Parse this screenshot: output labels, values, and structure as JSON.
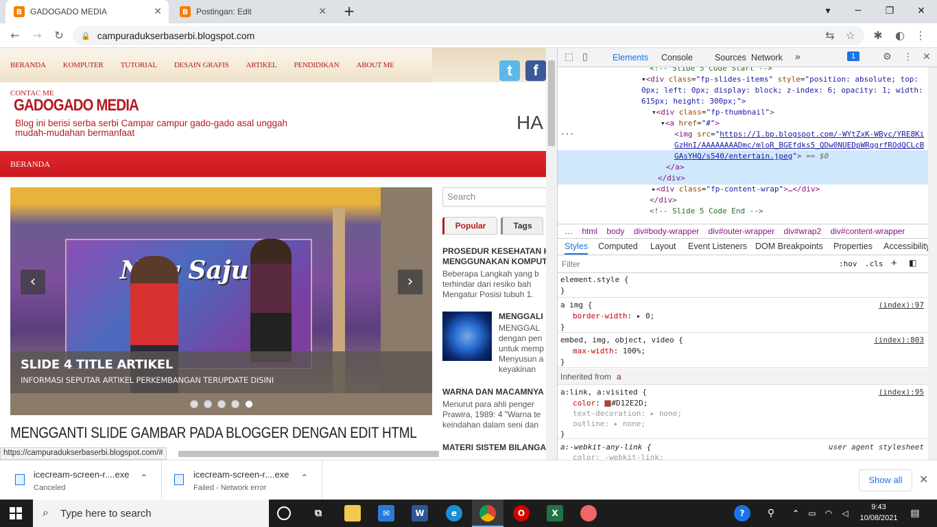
{
  "browser": {
    "tabs": [
      {
        "label": "GADOGADO MEDIA",
        "active": true
      },
      {
        "label": "Postingan: Edit",
        "active": false
      }
    ],
    "url": "campuradukserbaserbi.blogspot.com"
  },
  "page": {
    "menu": [
      "BERANDA",
      "KOMPUTER",
      "TUTORIAL",
      "DESAIN GRAFIS",
      "ARTIKEL",
      "PENDIDIKAN",
      "ABOUT ME"
    ],
    "contact": "CONTAC ME",
    "blog_title": "GADOGADO MEDIA",
    "blog_desc": "Blog ini berisi serba serbi Campar campur gado-gado asal unggah mudah-mudahan bermanfaat",
    "ha_text": "HA",
    "red_bar_label": "BERANDA",
    "slider": {
      "banner_text": "New Sajum",
      "caption_title": "SLIDE 4 TITLE ARTIKEL",
      "caption_sub": "INFORMASI SEPUTAR ARTIKEL PERKEMBANGAN TERUPDATE DISINI",
      "prev": "‹",
      "next": "›",
      "dots": 5,
      "active_dot": 5
    },
    "post_title": "MENGGANTI SLIDE GAMBAR PADA BLOGGER DENGAN EDIT HTML",
    "sidebar": {
      "search_placeholder": "Search",
      "tab_popular": "Popular",
      "tab_tags": "Tags",
      "post1_title_l1": "PROSEDUR KESEHATAN K",
      "post1_title_l2": "MENGGUNAKAN KOMPUT",
      "post1_text_l1": "Beberapa Langkah yang b",
      "post1_text_l2": "terhindar dari resiko bah",
      "post1_text_l3": "Mengatur Posisi tubuh 1.",
      "post2_title": "MENGGALI",
      "post2_text_l1": "MENGGAL",
      "post2_text_l2": "dengan pen",
      "post2_text_l3": "untuk memp",
      "post2_text_l4": "Menyusun a",
      "post2_text_l5": "keyakinan",
      "post3_title": "WARNA DAN MACAMNYA",
      "post3_text_l1": "Menurut  para ahli penger",
      "post3_text_l2": "Prawira, 1989: 4 \"Warna te",
      "post3_text_l3": "keindahan dalam seni dan",
      "post4_title": "MATERI SISTEM BILANGA"
    },
    "status_url": "https://campuradukserbaserbi.blogspot.com/#"
  },
  "devtools": {
    "tabs": [
      "Elements",
      "Console",
      "Sources",
      "Network"
    ],
    "more": "»",
    "issues_count": "1",
    "dom": {
      "l1": "<!-- Slide 5 Code Start -->",
      "l2_tag": "div",
      "l2_class": "fp-slides-items",
      "l2_style": "position: absolute; top:",
      "l3": "0px; left: 0px; display: block; z-index: 6; opacity: 1; width:",
      "l4": "615px; height: 300px;\">",
      "l5_class": "fp-thumbnail",
      "l6_href": "#",
      "l7_src1": "https://1.bp.blogspot.com/-WYtZxK-WByc/YRE8Ki",
      "l7_src2": "GzHnI/AAAAAAAADmc/mloR_BGEfdks5_QDw0NUEDpWRggrfROdQCLcB",
      "l7_src3": "GAsYHQ/s540/entertain.jpeg",
      "l7_suffix": "== $0",
      "l8": "</a>",
      "l9": "</div>",
      "l10_class": "fp-content-wrap",
      "l11": "</div>",
      "l12": "<!-- Slide 5 Code End -->"
    },
    "crumbs": [
      "html",
      "body",
      "div#body-wrapper",
      "div#outer-wrapper",
      "div#wrap2",
      "div#content-wrapper"
    ],
    "sub_tabs": [
      "Styles",
      "Computed",
      "Layout",
      "Event Listeners",
      "DOM Breakpoints",
      "Properties",
      "Accessibility"
    ],
    "filter_placeholder": "Filter",
    "filter_hov": ":hov",
    "filter_cls": ".cls",
    "styles": {
      "r1_sel": "element.style {",
      "r2_sel": "a img {",
      "r2_src": "(index):97",
      "r2_prop": "border-width",
      "r2_val": "0;",
      "r3_sel": "embed, img, object, video {",
      "r3_src": "(index):803",
      "r3_prop": "max-width",
      "r3_val": "100%;",
      "inherited": "Inherited from",
      "inherited_el": "a",
      "r4_sel": "a:link, a:visited {",
      "r4_src": "(index):95",
      "r4_prop1": "color",
      "r4_val1": "#D12E2D;",
      "r4_prop2": "text-decoration",
      "r4_val2": "none;",
      "r4_prop3": "outline",
      "r4_val3": "none;",
      "r5_sel": "a:-webkit-any-link {",
      "r5_src": "user agent stylesheet",
      "r5_prop": "color: -webkit-link;"
    },
    "swatch_color": "#D12E2D"
  },
  "downloads": [
    {
      "name": "icecream-screen-r....exe",
      "status": "Canceled"
    },
    {
      "name": "icecream-screen-r....exe",
      "status": "Failed - Network error"
    }
  ],
  "show_all": "Show all",
  "taskbar": {
    "search_placeholder": "Type here to search",
    "time": "9:43",
    "date": "10/08/2021"
  }
}
